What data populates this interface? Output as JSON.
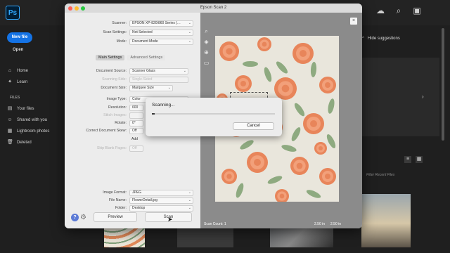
{
  "photoshop": {
    "logo": "Ps",
    "new_file": "New file",
    "open": "Open",
    "nav": [
      {
        "label": "Home",
        "icon": "home-icon"
      },
      {
        "label": "Learn",
        "icon": "lightbulb-icon"
      }
    ],
    "files_section": "FILES",
    "files": [
      {
        "label": "Your files",
        "icon": "file-icon"
      },
      {
        "label": "Shared with you",
        "icon": "people-icon"
      },
      {
        "label": "Lightroom photos",
        "icon": "lightroom-icon"
      },
      {
        "label": "Deleted",
        "icon": "trash-icon"
      }
    ],
    "hide_suggestions": "Hide suggestions",
    "filter_recent": "Filter Recent Files"
  },
  "scan_dialog": {
    "title": "Epson Scan 2",
    "fields": [
      {
        "label": "Scanner:",
        "value": "EPSON XP-820/860 Series (…",
        "dim": false
      },
      {
        "label": "Scan Settings:",
        "value": "Not Selected",
        "dim": false
      },
      {
        "label": "Mode:",
        "value": "Document Mode",
        "dim": false
      }
    ],
    "tabs": {
      "main": "Main Settings",
      "advanced": "Advanced Settings"
    },
    "main_fields": [
      {
        "label": "Document Source:",
        "value": "Scanner Glass",
        "dim": false
      },
      {
        "label": "Scanning Side:",
        "value": "Single-Sided",
        "dim": true
      },
      {
        "label": "Document Size:",
        "value": "Marquee Size",
        "dim": false
      },
      {
        "label": "Image Type:",
        "value": "Color",
        "dim": false
      },
      {
        "label": "Resolution:",
        "value": "600",
        "dim": false
      },
      {
        "label": "Stitch Images:",
        "value": "",
        "dim": true
      },
      {
        "label": "Rotate:",
        "value": "0°",
        "dim": false
      },
      {
        "label": "Correct Document Skew:",
        "value": "Off",
        "dim": false
      },
      {
        "label": "",
        "value": "Add",
        "dim": false
      },
      {
        "label": "Skip Blank Pages:",
        "value": "Off",
        "dim": true
      }
    ],
    "output_fields": [
      {
        "label": "Image Format:",
        "value": "JPEG"
      },
      {
        "label": "File Name:",
        "value": "FlowerDetail.jpg"
      },
      {
        "label": "Folder:",
        "value": "Desktop"
      }
    ],
    "preview_button": "Preview",
    "scan_button": "Scan",
    "scan_count": "Scan Count: 1",
    "width_readout": "2.50 in",
    "height_readout": "2.50 in",
    "close": "×"
  },
  "progress_dialog": {
    "status": "Scanning...",
    "progress": 0.02,
    "cancel_button": "Cancel"
  },
  "colors": {
    "accent_blue": "#1473e6",
    "flower_orange": "#e8855a",
    "leaf_green": "#7e9f70"
  }
}
